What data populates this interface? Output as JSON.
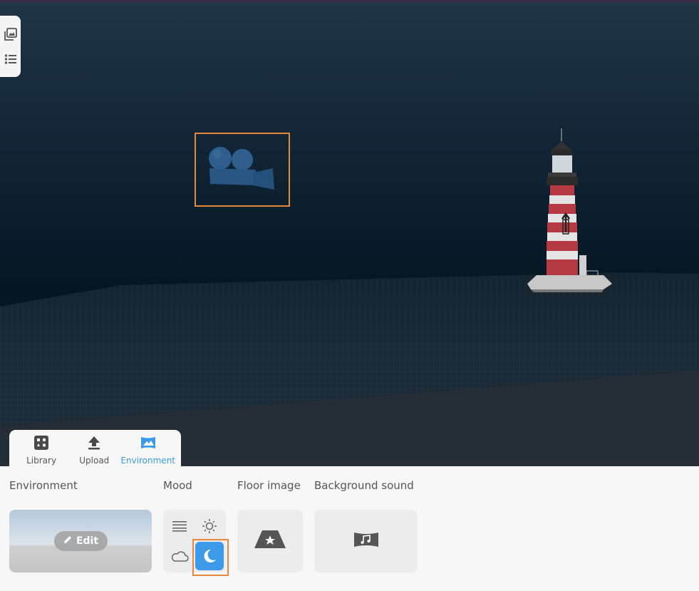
{
  "tabs": [
    {
      "label": "Library",
      "icon": "library-icon"
    },
    {
      "label": "Upload",
      "icon": "upload-icon"
    },
    {
      "label": "Environment",
      "icon": "environment-icon",
      "active": true
    }
  ],
  "panel": {
    "environment": {
      "title": "Environment",
      "edit_label": "Edit"
    },
    "mood": {
      "title": "Mood",
      "options": [
        "list-icon",
        "sun-icon",
        "cloud-icon",
        "moon-icon"
      ],
      "selected": "moon-icon"
    },
    "floor_image": {
      "title": "Floor image",
      "icon": "floor-image-icon"
    },
    "background_sound": {
      "title": "Background sound",
      "icon": "sound-icon"
    }
  },
  "side_toolbar": [
    "gallery-icon",
    "list-icon"
  ],
  "colors": {
    "accent": "#3d9ae8",
    "selection": "#e8893a"
  }
}
